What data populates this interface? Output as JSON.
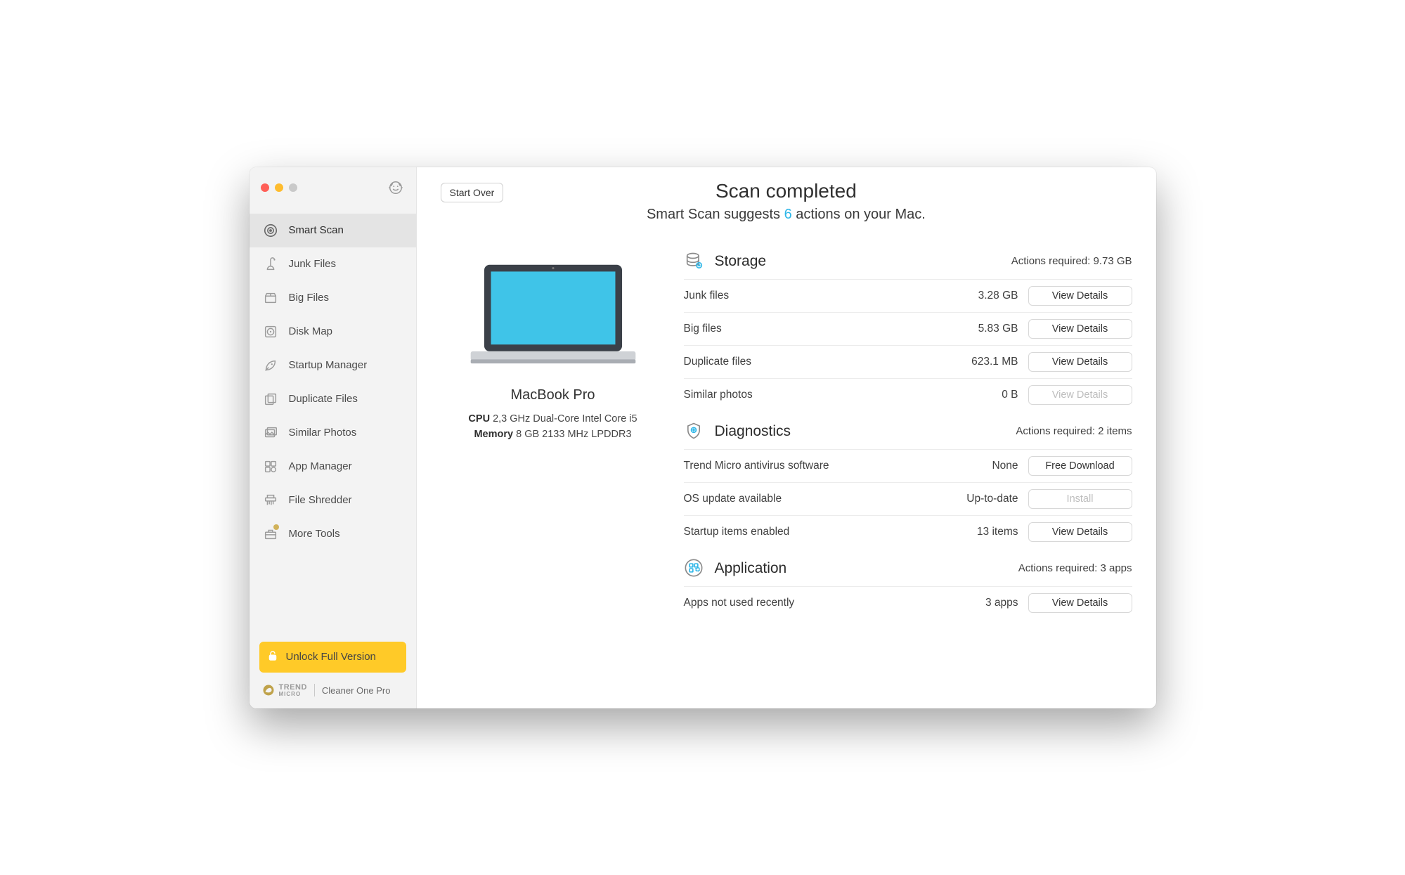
{
  "sidebar": {
    "items": [
      {
        "label": "Smart Scan"
      },
      {
        "label": "Junk Files"
      },
      {
        "label": "Big Files"
      },
      {
        "label": "Disk Map"
      },
      {
        "label": "Startup Manager"
      },
      {
        "label": "Duplicate Files"
      },
      {
        "label": "Similar Photos"
      },
      {
        "label": "App Manager"
      },
      {
        "label": "File Shredder"
      },
      {
        "label": "More Tools"
      }
    ],
    "active_index": 0,
    "unlock_label": "Unlock Full Version",
    "brand_primary": "TREND",
    "brand_secondary": "MICRO",
    "brand_product": "Cleaner One Pro"
  },
  "header": {
    "start_over": "Start Over",
    "title": "Scan completed",
    "subhead_prefix": "Smart Scan suggests ",
    "action_count": "6",
    "subhead_suffix": " actions on your Mac."
  },
  "device": {
    "name": "MacBook Pro",
    "cpu_label": "CPU",
    "cpu_value": "2,3 GHz Dual-Core Intel Core i5",
    "mem_label": "Memory",
    "mem_value": "8 GB 2133 MHz LPDDR3"
  },
  "sections": [
    {
      "title": "Storage",
      "required": "Actions required: 9.73 GB",
      "rows": [
        {
          "label": "Junk files",
          "value": "3.28 GB",
          "action": "View Details",
          "disabled": false
        },
        {
          "label": "Big files",
          "value": "5.83 GB",
          "action": "View Details",
          "disabled": false
        },
        {
          "label": "Duplicate files",
          "value": "623.1 MB",
          "action": "View Details",
          "disabled": false
        },
        {
          "label": "Similar photos",
          "value": "0 B",
          "action": "View Details",
          "disabled": true
        }
      ]
    },
    {
      "title": "Diagnostics",
      "required": "Actions required: 2 items",
      "rows": [
        {
          "label": "Trend Micro antivirus software",
          "value": "None",
          "action": "Free Download",
          "disabled": false
        },
        {
          "label": "OS update available",
          "value": "Up-to-date",
          "action": "Install",
          "disabled": true
        },
        {
          "label": "Startup items enabled",
          "value": "13 items",
          "action": "View Details",
          "disabled": false
        }
      ]
    },
    {
      "title": "Application",
      "required": "Actions required: 3 apps",
      "rows": [
        {
          "label": "Apps not used recently",
          "value": "3 apps",
          "action": "View Details",
          "disabled": false
        }
      ]
    }
  ]
}
